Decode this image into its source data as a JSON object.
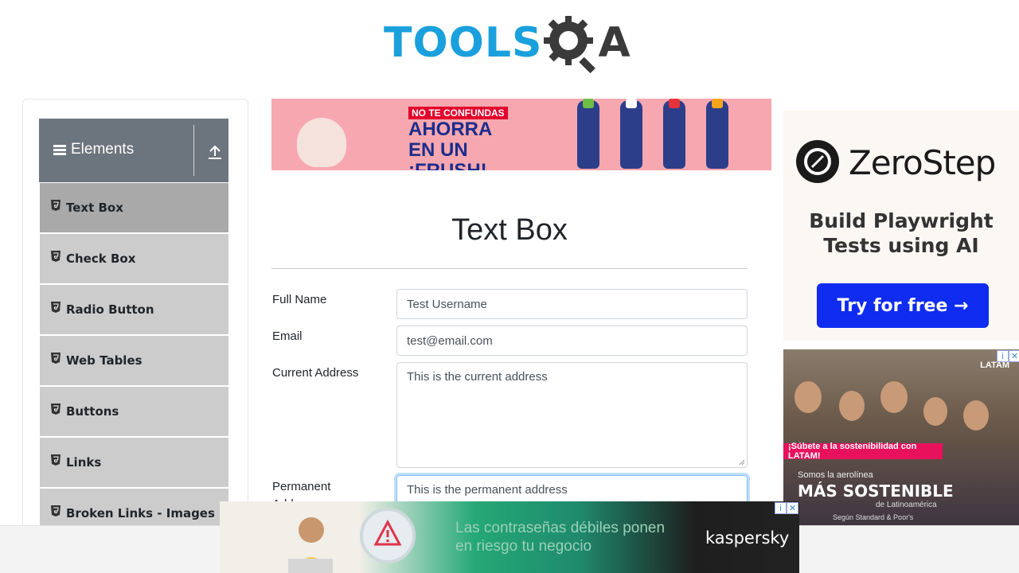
{
  "header": {
    "logo_text": "TOOLS",
    "logo_qa": "A"
  },
  "sidebar": {
    "group_title": "Elements",
    "items": [
      {
        "label": "Text Box",
        "active": true
      },
      {
        "label": "Check Box",
        "active": false
      },
      {
        "label": "Radio Button",
        "active": false
      },
      {
        "label": "Web Tables",
        "active": false
      },
      {
        "label": "Buttons",
        "active": false
      },
      {
        "label": "Links",
        "active": false
      },
      {
        "label": "Broken Links - Images",
        "active": false
      }
    ]
  },
  "banner_ad": {
    "line1": "NO TE CONFUNDAS",
    "line2": "AHORRA EN UN ¡FRUSH!",
    "bottle_colors": [
      "#6cbe45",
      "#ffffff",
      "#e5333c",
      "#f4a51c"
    ]
  },
  "main": {
    "title": "Text Box",
    "form": {
      "full_name": {
        "label": "Full Name",
        "value": "Test Username"
      },
      "email": {
        "label": "Email",
        "value": "test@email.com"
      },
      "current_address": {
        "label": "Current Address",
        "value": "This is the current address"
      },
      "permanent_address": {
        "label": "Permanent Address",
        "label_visible": "Permanent",
        "label_line2_visible": "Addr",
        "value": "This is the permanent address"
      }
    }
  },
  "right_ads": {
    "zerostep": {
      "brand": "ZeroStep",
      "tagline_line1": "Build Playwright",
      "tagline_line2": "Tests using AI",
      "cta": "Try for free →"
    },
    "latam": {
      "brand": "LATAM",
      "strip": "¡Súbete a la sostenibilidad con LATAM!",
      "small": "Somos la aerolínea",
      "big": "MÁS SOSTENIBLE",
      "sub": "de Latinoamérica",
      "foot": "Según Standard & Poor's"
    }
  },
  "bottom_ad": {
    "text_line1": "Las contraseñas débiles ponen",
    "text_line2": "en riesgo tu negocio",
    "brand": "kaspersky"
  },
  "colors": {
    "nav_header": "#6c757d",
    "nav_item": "#cccccc",
    "nav_item_active": "#a9a9a9",
    "logo_blue": "#1aa0dc",
    "focus_blue": "#80bdff"
  }
}
